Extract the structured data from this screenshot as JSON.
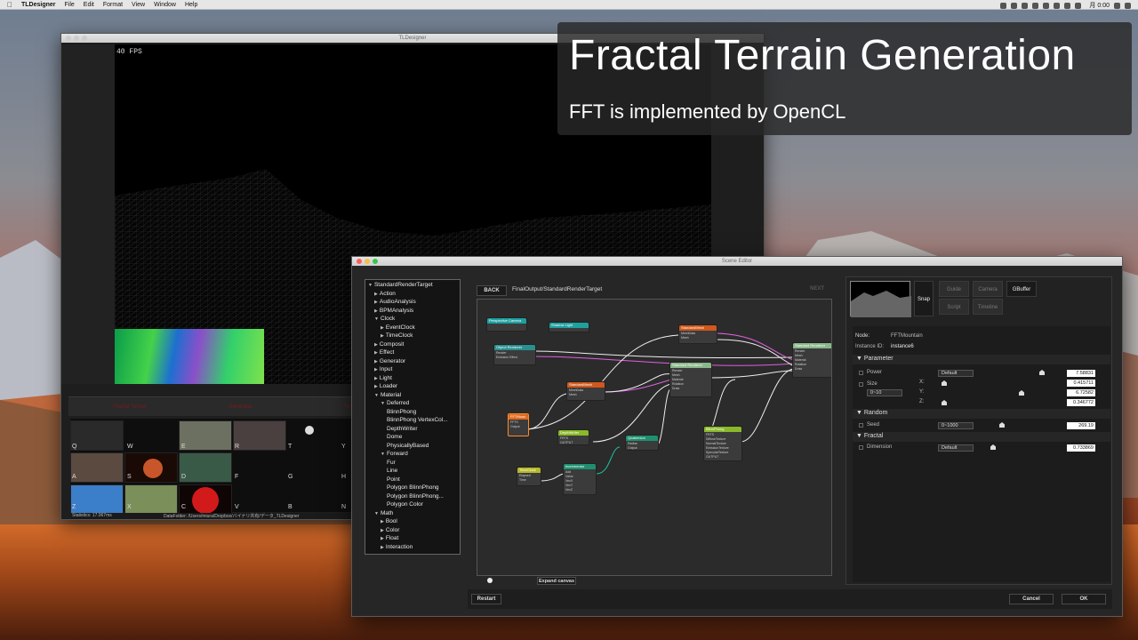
{
  "menubar": {
    "app_name": "TLDesigner",
    "menus": [
      "File",
      "Edit",
      "Format",
      "View",
      "Window",
      "Help"
    ],
    "clock": "月 0:00"
  },
  "main_window": {
    "title": "TLDesigner",
    "fps": "40 FPS",
    "redbar_labels": [
      "Fractal Terrain",
      "Generator",
      "Terrain"
    ],
    "palette_keys": [
      "Q",
      "W",
      "E",
      "R",
      "T",
      "Y",
      "A",
      "S",
      "D",
      "F",
      "G",
      "H",
      "Z",
      "X",
      "C",
      "V",
      "B",
      "N"
    ],
    "status_left": "Statistics: 17.067ms",
    "status_right": "DataFolder: /Users/miura/Dropbox/バイナリ共有/データ_TLDesigner"
  },
  "caption": {
    "title": "Fractal Terrain Generation",
    "subtitle": "FFT is implemented by OpenCL"
  },
  "scene_editor": {
    "title": "Scene Editor",
    "back_label": "BACK",
    "path": "FinalOutput/StandardRenderTarget",
    "next_label": "NEXT",
    "expand_label": "Expand canvas",
    "restart_label": "Restart",
    "cancel_label": "Cancel",
    "ok_label": "OK",
    "tree": [
      {
        "label": "StandardRenderTarget",
        "depth": 0,
        "open": true
      },
      {
        "label": "Action",
        "depth": 1
      },
      {
        "label": "AudioAnalysis",
        "depth": 1
      },
      {
        "label": "BPMAnalysis",
        "depth": 1
      },
      {
        "label": "Clock",
        "depth": 1,
        "open": true
      },
      {
        "label": "EventClock",
        "depth": 2
      },
      {
        "label": "TimeClock",
        "depth": 2
      },
      {
        "label": "Composit",
        "depth": 1
      },
      {
        "label": "Effect",
        "depth": 1
      },
      {
        "label": "Generator",
        "depth": 1
      },
      {
        "label": "Input",
        "depth": 1
      },
      {
        "label": "Light",
        "depth": 1
      },
      {
        "label": "Loader",
        "depth": 1
      },
      {
        "label": "Material",
        "depth": 1,
        "open": true
      },
      {
        "label": "Deferred",
        "depth": 2,
        "open": true
      },
      {
        "label": "BlinnPhong",
        "depth": 3
      },
      {
        "label": "BlinnPhong VertexCol...",
        "depth": 3
      },
      {
        "label": "DepthWriter",
        "depth": 3
      },
      {
        "label": "Dome",
        "depth": 3
      },
      {
        "label": "PhysicallyBased",
        "depth": 3
      },
      {
        "label": "Forward",
        "depth": 2,
        "open": true
      },
      {
        "label": "Fur",
        "depth": 3
      },
      {
        "label": "Line",
        "depth": 3
      },
      {
        "label": "Point",
        "depth": 3
      },
      {
        "label": "Polygon BlinnPhong",
        "depth": 3
      },
      {
        "label": "Polygon BlinnPhong...",
        "depth": 3
      },
      {
        "label": "Polygon Color",
        "depth": 3
      },
      {
        "label": "Math",
        "depth": 1,
        "open": true
      },
      {
        "label": "Bool",
        "depth": 2
      },
      {
        "label": "Color",
        "depth": 2
      },
      {
        "label": "Float",
        "depth": 2
      },
      {
        "label": "Interaction",
        "depth": 2
      }
    ],
    "nodes": [
      {
        "id": "persp",
        "title": "Perspective Camera",
        "color": "#1fa0a0",
        "ports": []
      },
      {
        "id": "shadow",
        "title": "Shadow Light",
        "color": "#1fa0a0",
        "ports": []
      },
      {
        "id": "objrend",
        "title": "Object Renderer",
        "color": "#2a8f8f",
        "ports": [
          "Render",
          "Emission Effect"
        ]
      },
      {
        "id": "stdmesh1",
        "title": "StandardMesh",
        "color": "#d0581c",
        "ports": [
          "MeshData",
          "Mesh"
        ]
      },
      {
        "id": "stdmesh2",
        "title": "StandardMesh",
        "color": "#d0581c",
        "ports": [
          "MeshData",
          "Mesh"
        ]
      },
      {
        "id": "stdrend1",
        "title": "Standard Renderer",
        "color": "#8ab88a",
        "ports": [
          "Render",
          "Mesh",
          "Material",
          "Rotation",
          "Draw"
        ]
      },
      {
        "id": "stdrend2",
        "title": "Standard Renderer",
        "color": "#8ab88a",
        "ports": [
          "Render",
          "Mesh",
          "Material",
          "Rotation",
          "Draw"
        ]
      },
      {
        "id": "fft",
        "title": "FFTMoun",
        "color": "#e06a1c",
        "ports": [
          "FFTS",
          "Output"
        ]
      },
      {
        "id": "depth",
        "title": "DepthWriter",
        "color": "#8ab82a",
        "ports": [
          "FRTS",
          "OUTPUT"
        ]
      },
      {
        "id": "quat",
        "title": "Quaternion",
        "color": "#1f8f6f",
        "ports": [
          "Radian",
          "Output"
        ]
      },
      {
        "id": "blinn",
        "title": "BlinnPhong",
        "color": "#8ab82a",
        "ports": [
          "FRTS",
          "DiffuseTexture",
          "NormalTexture",
          "EmissionTexture",
          "SpecularTexture",
          "OUTPUT"
        ]
      },
      {
        "id": "time",
        "title": "TimeClock",
        "color": "#b8b82a",
        "ports": [
          "Elapsed",
          "Time"
        ]
      },
      {
        "id": "incr",
        "title": "Incrementor",
        "color": "#1f8f6f",
        "ports": [
          "Add",
          "Value",
          "VecX",
          "VecY",
          "VecZ"
        ]
      }
    ],
    "properties": {
      "toolbar": [
        "Snap",
        "Guide",
        "Camera",
        "GBuffer",
        "Script",
        "Timeline"
      ],
      "node_label": "Node:",
      "node_value": "FFTMountain",
      "instance_label": "Instance ID:",
      "instance_value": "instance6",
      "sections": {
        "parameter": "Parameter",
        "random": "Random",
        "fractal": "Fractal"
      },
      "power": {
        "label": "Power",
        "mode": "Default",
        "value": "7.58831"
      },
      "size": {
        "label": "Size",
        "range": "0~10",
        "x_label": "X:",
        "y_label": "Y:",
        "z_label": "Z:",
        "x": "0.415711",
        "y": "6.72582",
        "z": "0.346772"
      },
      "seed": {
        "label": "Seed",
        "range": "0~1000",
        "value": "269.19"
      },
      "dimension": {
        "label": "Dimension",
        "mode": "Default",
        "value": "0.733869"
      }
    }
  }
}
